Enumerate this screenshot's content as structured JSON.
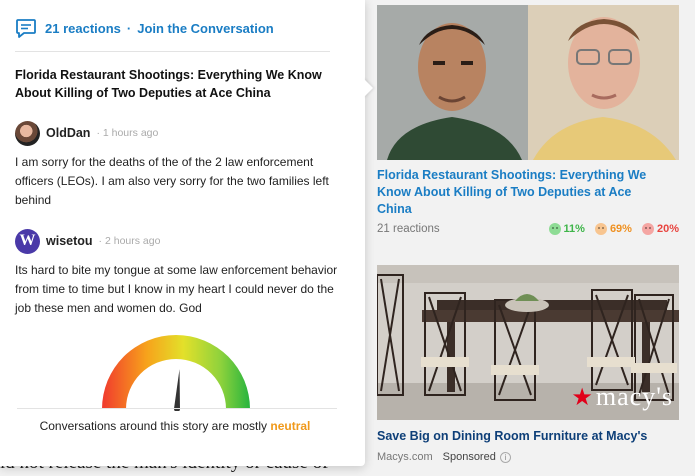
{
  "background": {
    "article_text": "ld not release the man's identity or cause of"
  },
  "popup": {
    "reactions_count": "21 reactions",
    "separator": "·",
    "join_label": "Join the Conversation",
    "story_title": "Florida Restaurant Shootings: Everything We Know About Killing of Two Deputies at Ace China",
    "comments": [
      {
        "user": "OldDan",
        "time": "1 hours ago",
        "text": "I am sorry for the deaths of the of the 2 law enforcement officers (LEOs). I am also very sorry for the two families left behind"
      },
      {
        "user": "wisetou",
        "avatar_letter": "W",
        "time": "2 hours ago",
        "text": "Its hard to bite my tongue at some law enforcement behavior from time to time but I know in my heart I could never do the job these men and women do. God"
      }
    ],
    "sentiment": {
      "caption_prefix": "Conversations around this story are mostly",
      "value": "neutral",
      "gauge_level": 0.52
    }
  },
  "sidebar": {
    "cards": [
      {
        "title": "Florida Restaurant Shootings: Everything We Know About Killing of Two Deputies at Ace China",
        "reactions": "21 reactions",
        "positive": "11%",
        "neutral": "69%",
        "negative": "20%"
      },
      {
        "title": "Save Big on Dining Room Furniture at Macy's",
        "source": "Macys.com",
        "sponsored": "Sponsored",
        "brand": "macy's",
        "info_icon": "i"
      }
    ]
  },
  "colors": {
    "link": "#1a7dc4",
    "neutral": "#f0991a",
    "positive": "#3fb54a",
    "negative": "#e8443f"
  }
}
